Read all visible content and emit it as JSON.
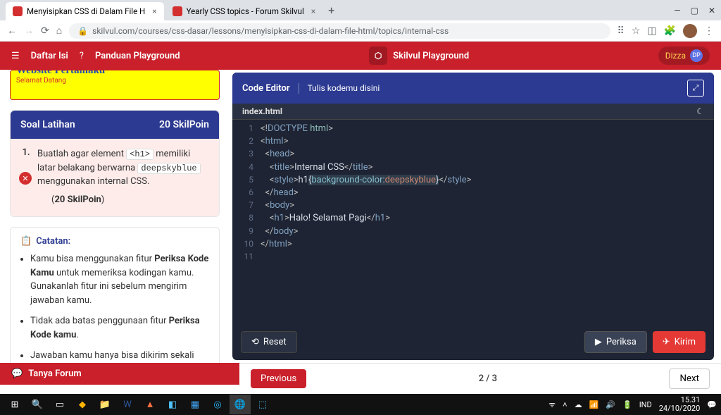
{
  "browser": {
    "tabs": [
      {
        "favicon": "skilvul",
        "title": "Menyisipkan CSS di Dalam File H"
      },
      {
        "favicon": "skilvul",
        "title": "Yearly CSS topics - Forum Skilvul"
      }
    ],
    "url": "skilvul.com/courses/css-dasar/lessons/menyisipkan-css-di-dalam-file-html/topics/internal-css"
  },
  "header": {
    "menu_label": "Daftar Isi",
    "help_label": "Panduan Playground",
    "brand": "Skilvul Playground",
    "user_name": "Dizza",
    "user_initials": "DP"
  },
  "preview": {
    "h1": "Website Pertamaku",
    "p": "Selamat Datang"
  },
  "exercise": {
    "title": "Soal Latihan",
    "points": "20 SkilPoin",
    "task_num": "1.",
    "task_text_1": "Buatlah agar element ",
    "task_chip_1": "<h1>",
    "task_text_2": " memiliki latar belakang berwarna ",
    "task_chip_2": "deepskyblue",
    "task_text_3": " menggunakan internal CSS.",
    "task_points": "(20 SkilPoin)"
  },
  "notes": {
    "title": "Catatan:",
    "items": [
      {
        "pre": "Kamu bisa menggunakan fitur ",
        "b": "Periksa Kode Kamu",
        "post": " untuk memeriksa kodingan kamu. Gunakanlah fitur ini sebelum mengirim jawaban kamu."
      },
      {
        "pre": "Tidak ada batas penggunaan fitur ",
        "b": "Periksa Kode kamu",
        "post": "."
      },
      {
        "pre": "Jawaban kamu hanya bisa dikirim sekali",
        "b": "",
        "post": ""
      }
    ]
  },
  "editor": {
    "title": "Code Editor",
    "subtitle": "Tulis kodemu disini",
    "file": "index.html",
    "reset": "Reset",
    "check": "Periksa",
    "submit": "Kirim",
    "code_lines": [
      {
        "n": 1,
        "html": "<span class='cm-bracket'>&lt;!</span><span class='cm-tag'>DOCTYPE</span> <span class='cm-attr'>html</span><span class='cm-bracket'>&gt;</span>"
      },
      {
        "n": 2,
        "html": "<span class='cm-bracket'>&lt;</span><span class='cm-tag'>html</span><span class='cm-bracket'>&gt;</span>"
      },
      {
        "n": 3,
        "html": "  <span class='cm-bracket'>&lt;</span><span class='cm-tag'>head</span><span class='cm-bracket'>&gt;</span>"
      },
      {
        "n": 4,
        "html": "    <span class='cm-bracket'>&lt;</span><span class='cm-tag'>title</span><span class='cm-bracket'>&gt;</span><span class='cm-text'>Internal CSS</span><span class='cm-bracket'>&lt;/</span><span class='cm-tag'>title</span><span class='cm-bracket'>&gt;</span>"
      },
      {
        "n": 5,
        "html": "    <span class='cm-bracket'>&lt;</span><span class='cm-tag'>style</span><span class='cm-bracket'>&gt;</span><span class='cm-text'>h1</span><span class='cm-sel'>{<span class='cm-prop'>background-color</span>:<span class='cm-val'>deepskyblue</span>}</span><span class='cm-bracket'>&lt;/</span><span class='cm-tag'>style</span><span class='cm-bracket'>&gt;</span>"
      },
      {
        "n": 6,
        "html": "  <span class='cm-bracket'>&lt;/</span><span class='cm-tag'>head</span><span class='cm-bracket'>&gt;</span>"
      },
      {
        "n": 7,
        "html": "  <span class='cm-bracket'>&lt;</span><span class='cm-tag'>body</span><span class='cm-bracket'>&gt;</span>"
      },
      {
        "n": 8,
        "html": "    <span class='cm-bracket'>&lt;</span><span class='cm-tag'>h1</span><span class='cm-bracket'>&gt;</span><span class='cm-text'>Halo! Selamat Pagi</span><span class='cm-bracket'>&lt;/</span><span class='cm-tag'>h1</span><span class='cm-bracket'>&gt;</span>"
      },
      {
        "n": 9,
        "html": "  <span class='cm-bracket'>&lt;/</span><span class='cm-tag'>body</span><span class='cm-bracket'>&gt;</span>"
      },
      {
        "n": 10,
        "html": "<span class='cm-bracket'>&lt;/</span><span class='cm-tag'>html</span><span class='cm-bracket'>&gt;</span>"
      },
      {
        "n": 11,
        "html": ""
      }
    ]
  },
  "progress": {
    "forum": "Tanya Forum",
    "prev": "Previous",
    "step": "2 / 3",
    "next": "Next"
  },
  "taskbar": {
    "time": "15.31",
    "date": "24/10/2020",
    "lang": "IND"
  }
}
